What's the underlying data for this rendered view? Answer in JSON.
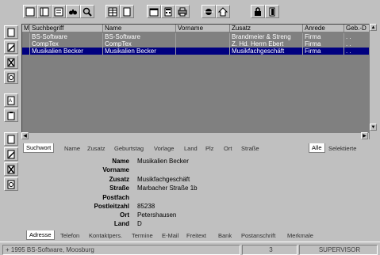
{
  "grid": {
    "headers": [
      "M",
      "Suchbegriff",
      "Name",
      "Vorname",
      "Zusatz",
      "Anrede",
      "Geb.-D"
    ],
    "rows": [
      {
        "m": "",
        "suchbegriff": "BS-Software",
        "name": "BS-Software",
        "vorname": "",
        "zusatz": "Brandmeier & Streng",
        "anrede": "Firma",
        "geb": ". ."
      },
      {
        "m": "",
        "suchbegriff": "CompTex",
        "name": "CompTex",
        "vorname": "",
        "zusatz": "Z. Hd. Herrn Ebert",
        "anrede": "Firma",
        "geb": ". ."
      },
      {
        "m": "",
        "suchbegriff": "Musikalien Becker",
        "name": "Musikalien Becker",
        "vorname": "",
        "zusatz": "Musikfachgeschäft",
        "anrede": "Firma",
        "geb": ". ."
      }
    ],
    "selected_row": 2
  },
  "top_tabs": [
    "Suchwort",
    "Name",
    "Zusatz",
    "Geburtstag",
    "Vorlage",
    "Land",
    "Plz",
    "Ort",
    "Straße"
  ],
  "filter_tabs": [
    "Alle",
    "Selektierte"
  ],
  "detail": {
    "fields": [
      {
        "label": "Name",
        "value": "Musikalien Becker"
      },
      {
        "label": "Vorname",
        "value": ""
      },
      {
        "label": "Zusatz",
        "value": "Musikfachgeschäft"
      },
      {
        "label": "Straße",
        "value": "Marbacher Straße  1b"
      },
      {
        "label": "Postfach",
        "value": ""
      },
      {
        "label": "Postleitzahl",
        "value": "85238"
      },
      {
        "label": "Ort",
        "value": "Petershausen"
      },
      {
        "label": "Land",
        "value": "D"
      }
    ]
  },
  "bottom_tabs": [
    "Adresse",
    "Telefon",
    "Kontaktpers.",
    "Termine",
    "E-Mail",
    "Freitext",
    "Bank",
    "Postanschrift",
    "Merkmale"
  ],
  "status": {
    "copyright": "+ 1995 BS-Software, Moosburg",
    "count": "3",
    "user": "SUPERVISOR"
  },
  "toolbar": {
    "icons": [
      "page-first-icon",
      "page-list-icon",
      "page-detail-icon",
      "binoculars-icon",
      "search-magnifier-icon",
      "table-icon",
      "blank-page-icon",
      "calendar-icon",
      "calculator-icon",
      "print-icon",
      "network-icon",
      "home-icon",
      "lock-icon",
      "door-exit-icon"
    ]
  }
}
